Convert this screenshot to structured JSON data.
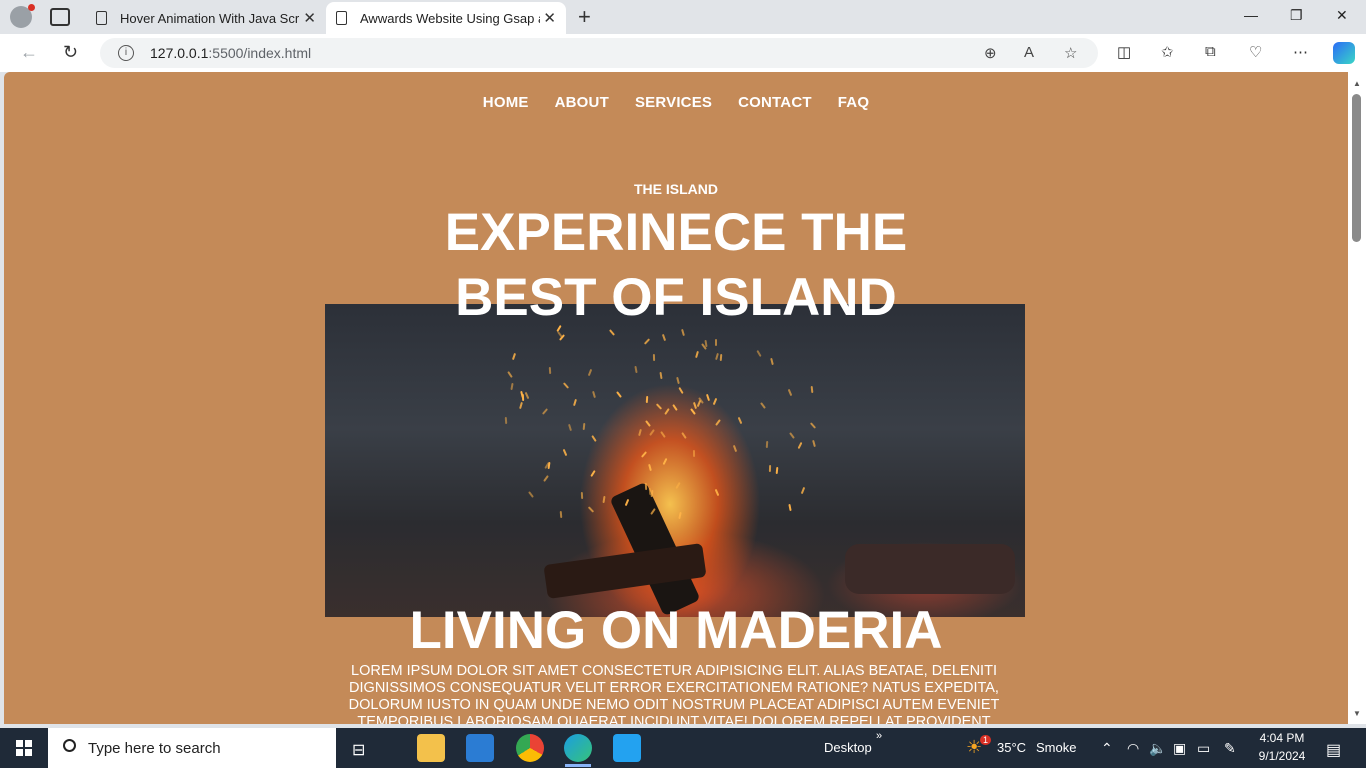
{
  "browser": {
    "tabs": [
      {
        "title": "Hover Animation With Java Script"
      },
      {
        "title": "Awwards Website Using Gsap and"
      }
    ],
    "url_host": "127.0.0.1",
    "url_path": ":5500/index.html"
  },
  "page": {
    "nav": [
      "HOME",
      "ABOUT",
      "SERVICES",
      "CONTACT",
      "FAQ"
    ],
    "eyebrow": "THE ISLAND",
    "headline_line1": "EXPERINECE THE",
    "headline_line2": "BEST OF ISLAND",
    "sub_headline": "LIVING ON MADERIA",
    "body": "LOREM IPSUM DOLOR SIT AMET CONSECTETUR ADIPISICING ELIT. ALIAS BEATAE, DELENITI DIGNISSIMOS CONSEQUATUR VELIT ERROR EXERCITATIONEM RATIONE? NATUS EXPEDITA, DOLORUM IUSTO IN QUAM UNDE NEMO ODIT NOSTRUM PLACEAT ADIPISCI AUTEM EVENIET TEMPORIBUS LABORIOSAM QUAERAT INCIDUNT VITAE! DOLOREM REPELLAT PROVIDENT",
    "background_color": "#c48a58"
  },
  "taskbar": {
    "search_placeholder": "Type here to search",
    "desktop_label": "Desktop",
    "weather_temp": "35°C",
    "weather_desc": "Smoke",
    "weather_badge": "1",
    "time": "4:04 PM",
    "date": "9/1/2024"
  }
}
